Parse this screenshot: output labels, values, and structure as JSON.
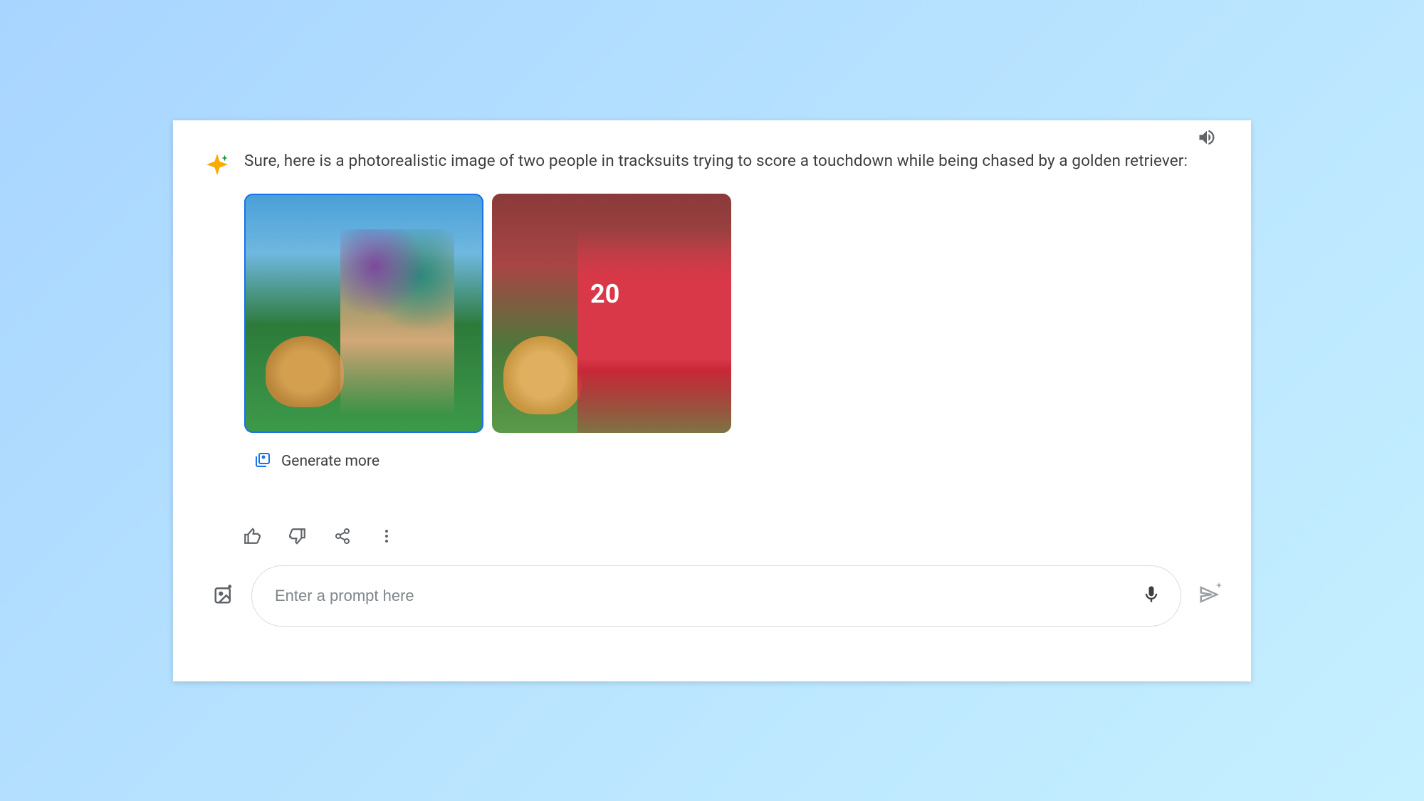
{
  "response": {
    "text": "Sure, here is a photorealistic image of two people in tracksuits trying to score a touchdown while being chased by a golden retriever:",
    "images": [
      {
        "selected": true,
        "alt": "Two football players in colorful uniforms running with a golden retriever on a green field"
      },
      {
        "selected": false,
        "alt": "Two football players in red jerseys numbered 20 running with a golden retriever",
        "jersey_number": "20"
      }
    ],
    "generate_more_label": "Generate more"
  },
  "input": {
    "placeholder": "Enter a prompt here"
  },
  "icons": {
    "sparkle": "sparkle-icon",
    "speaker": "speaker-icon",
    "thumbs_up": "thumbs-up-icon",
    "thumbs_down": "thumbs-down-icon",
    "share": "share-icon",
    "more": "more-icon",
    "image_add": "image-add-icon",
    "mic": "mic-icon",
    "send": "send-icon",
    "generate_more": "image-stack-icon"
  }
}
